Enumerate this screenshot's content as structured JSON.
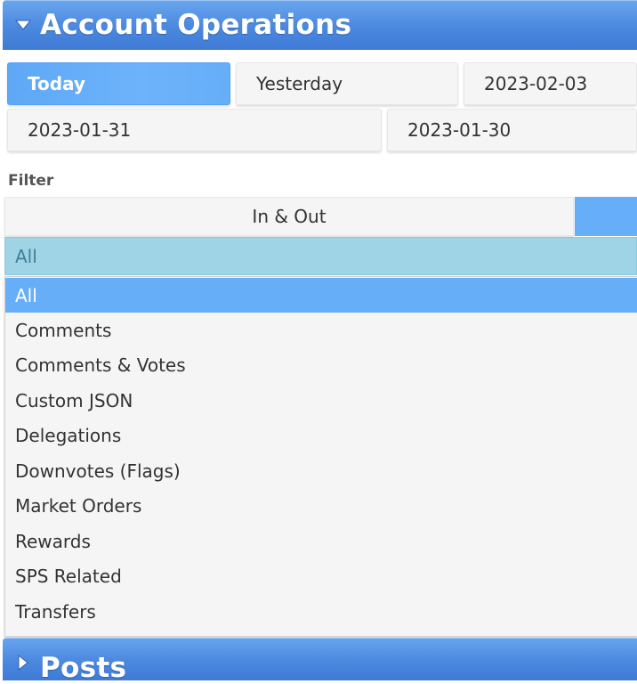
{
  "header": {
    "title": "Account Operations",
    "icon": "triangle-down-icon"
  },
  "date_buttons": [
    {
      "label": "Today",
      "active": true
    },
    {
      "label": "Yesterday",
      "active": false
    },
    {
      "label": "2023-02-03",
      "active": false
    },
    {
      "label": "2023-01-31",
      "active": false
    },
    {
      "label": "2023-01-30",
      "active": false
    }
  ],
  "filter": {
    "label": "Filter",
    "direction_options": [
      "In & Out",
      ""
    ],
    "select": {
      "selected": "All",
      "options": [
        "All",
        "Comments",
        "Comments & Votes",
        "Custom JSON",
        "Delegations",
        "Downvotes (Flags)",
        "Market Orders",
        "Rewards",
        "SPS Related",
        "Transfers"
      ]
    }
  },
  "posts_header": {
    "title": "Posts",
    "icon": "triangle-right-icon"
  },
  "colors": {
    "header_blue": "#4b88df",
    "active_blue": "#66aef8",
    "select_bg": "#9fd4e6",
    "button_bg": "#f5f5f5"
  }
}
